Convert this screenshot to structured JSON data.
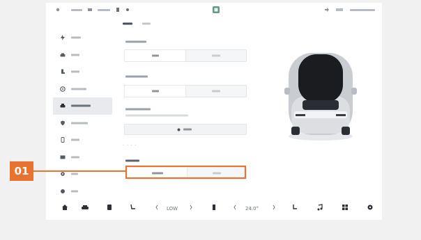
{
  "status_bar": {
    "left_items": [
      "",
      "",
      "",
      ""
    ],
    "right_items": [
      "",
      ""
    ],
    "center_icon": "app-icon"
  },
  "tabs": [
    {
      "label": "",
      "active": true
    },
    {
      "label": "",
      "active": false
    }
  ],
  "sidebar": {
    "items": [
      {
        "label": "",
        "icon": "bolt-icon",
        "active": false
      },
      {
        "label": "",
        "icon": "car-icon",
        "active": false
      },
      {
        "label": "",
        "icon": "seat-icon",
        "active": false
      },
      {
        "label": "",
        "icon": "wheel-icon",
        "active": false
      },
      {
        "label": "",
        "icon": "car-front-icon",
        "active": true
      },
      {
        "label": "",
        "icon": "shield-icon",
        "active": false
      },
      {
        "label": "",
        "icon": "phone-icon",
        "active": false
      },
      {
        "label": "",
        "icon": "map-icon",
        "active": false
      },
      {
        "label": "",
        "icon": "gear-icon",
        "active": false
      },
      {
        "label": "",
        "icon": "info-icon",
        "active": false
      }
    ]
  },
  "settings": {
    "group1": {
      "label": "",
      "options": [
        "",
        ""
      ],
      "selected_index": 0
    },
    "group2": {
      "label": "",
      "options": [
        "",
        ""
      ],
      "selected_index": 0
    },
    "group3": {
      "label": "",
      "description": "",
      "button_label": ""
    },
    "section_dots": "· · · ·",
    "group4": {
      "label": "",
      "options": [
        "",
        ""
      ],
      "selected_index": 0
    }
  },
  "callout": {
    "number": "01",
    "color": "#e8732e"
  },
  "bottom_bar": {
    "left_temp": "LOW",
    "right_temp": "24.0°",
    "icons": [
      "home-icon",
      "car-icon",
      "seat-heat-icon",
      "seat-recline-icon",
      "chevron-left-icon",
      "chevron-right-icon",
      "fan-icon",
      "chevron-left-icon",
      "chevron-right-icon",
      "seat-icon",
      "music-icon",
      "grid-icon",
      "settings-icon"
    ]
  },
  "colors": {
    "accent": "#e8732e",
    "screen_bg": "#ffffff",
    "page_bg": "#f1f1f2"
  }
}
